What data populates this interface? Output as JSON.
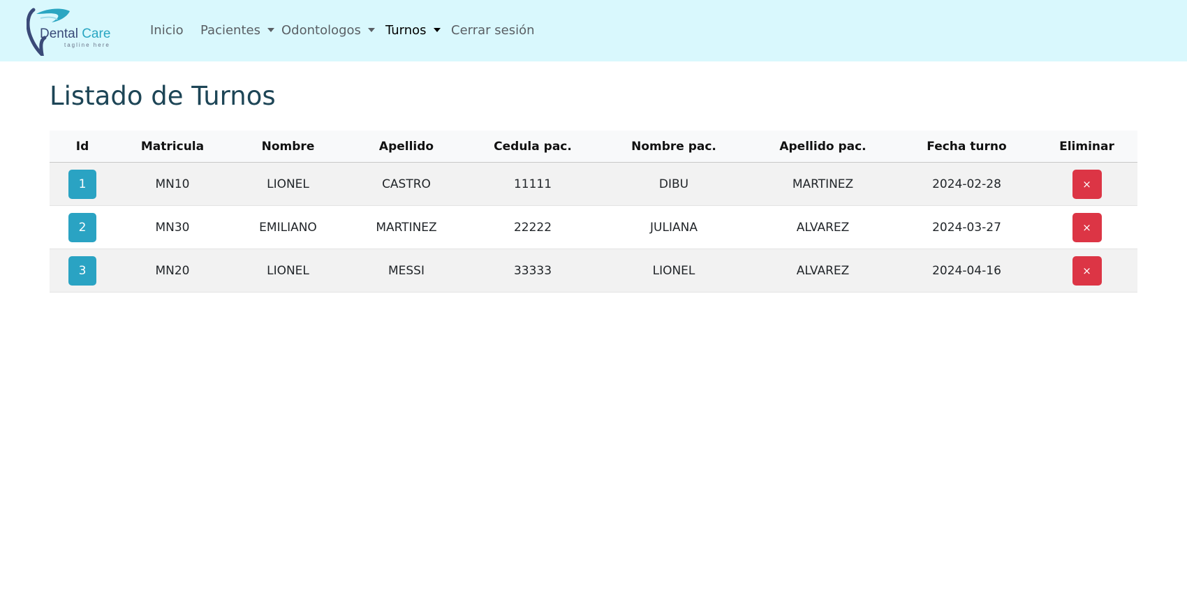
{
  "brand": {
    "name_part1": "Dental",
    "name_part2": "Care",
    "tagline": "tagline here",
    "colors": {
      "dark": "#3a4a78",
      "accent": "#2aa6c2"
    }
  },
  "nav": {
    "background": "#d9f8fd",
    "items": [
      {
        "label": "Inicio",
        "dropdown": false,
        "active": false
      },
      {
        "label": "Pacientes",
        "dropdown": true,
        "active": false
      },
      {
        "label": "Odontologos",
        "dropdown": true,
        "active": false
      },
      {
        "label": "Turnos",
        "dropdown": true,
        "active": true
      },
      {
        "label": "Cerrar sesión",
        "dropdown": false,
        "active": false
      }
    ]
  },
  "page": {
    "title": "Listado de Turnos"
  },
  "table": {
    "headers": [
      "Id",
      "Matricula",
      "Nombre",
      "Apellido",
      "Cedula pac.",
      "Nombre pac.",
      "Apellido pac.",
      "Fecha turno",
      "Eliminar"
    ],
    "delete_icon": "close-icon",
    "delete_glyph": "×",
    "colors": {
      "id_button": "#2aa3c3",
      "delete_button": "#dc3545"
    },
    "rows": [
      {
        "id": "1",
        "matricula": "MN10",
        "nombre": "LIONEL",
        "apellido": "CASTRO",
        "cedula": "11111",
        "nombre_pac": "DIBU",
        "apellido_pac": "MARTINEZ",
        "fecha": "2024-02-28"
      },
      {
        "id": "2",
        "matricula": "MN30",
        "nombre": "EMILIANO",
        "apellido": "MARTINEZ",
        "cedula": "22222",
        "nombre_pac": "JULIANA",
        "apellido_pac": "ALVAREZ",
        "fecha": "2024-03-27"
      },
      {
        "id": "3",
        "matricula": "MN20",
        "nombre": "LIONEL",
        "apellido": "MESSI",
        "cedula": "33333",
        "nombre_pac": "LIONEL",
        "apellido_pac": "ALVAREZ",
        "fecha": "2024-04-16"
      }
    ]
  }
}
